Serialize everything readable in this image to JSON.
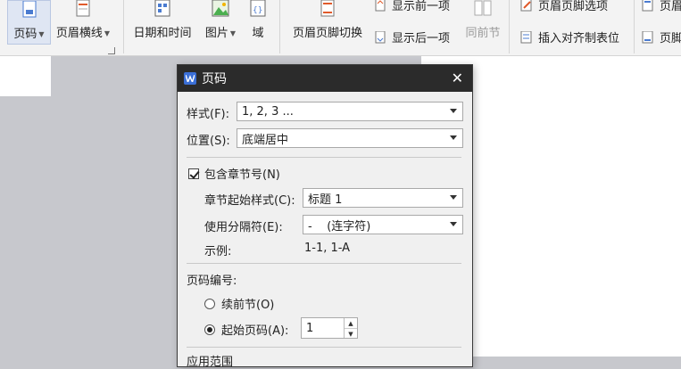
{
  "ribbon": {
    "page_number_label": "页码",
    "header_line_label": "页眉横线",
    "datetime_label": "日期和时间",
    "picture_label": "图片",
    "field_label": "域",
    "switch_label": "页眉页脚切换",
    "show_prev_label": "显示前一项",
    "show_next_label": "显示后一项",
    "same_as_prev_label": "同前节",
    "hf_options_label": "页眉页脚选项",
    "insert_align_tab_label": "插入对齐制表位",
    "right_top_label": "页眉",
    "right_bottom_label": "页脚"
  },
  "dialog": {
    "title": "页码",
    "close_glyph": "✕",
    "style_label": "样式(F):",
    "style_mnemonic": "F",
    "style_value": "1, 2, 3 ...",
    "position_label": "位置(S):",
    "position_mnemonic": "S",
    "position_value": "底端居中",
    "include_chapter_label": "包含章节号(N)",
    "chapter_start_style_label": "章节起始样式(C):",
    "chapter_start_style_value": "标题 1",
    "separator_label": "使用分隔符(E):",
    "separator_value": "-    (连字符)",
    "example_label": "示例:",
    "example_value": "1-1, 1-A",
    "numbering_label": "页码编号:",
    "continue_label": "续前节(O)",
    "start_at_label": "起始页码(A):",
    "start_at_value": "1",
    "apply_range_label": "应用范围"
  },
  "colors": {
    "ribbon_bg": "#f3f3f3",
    "dialog_title_bg": "#2b2b2b",
    "dialog_bg": "#f0f0f0",
    "workspace_bg": "#c7c8cd",
    "accent": "#3b6fd6"
  }
}
